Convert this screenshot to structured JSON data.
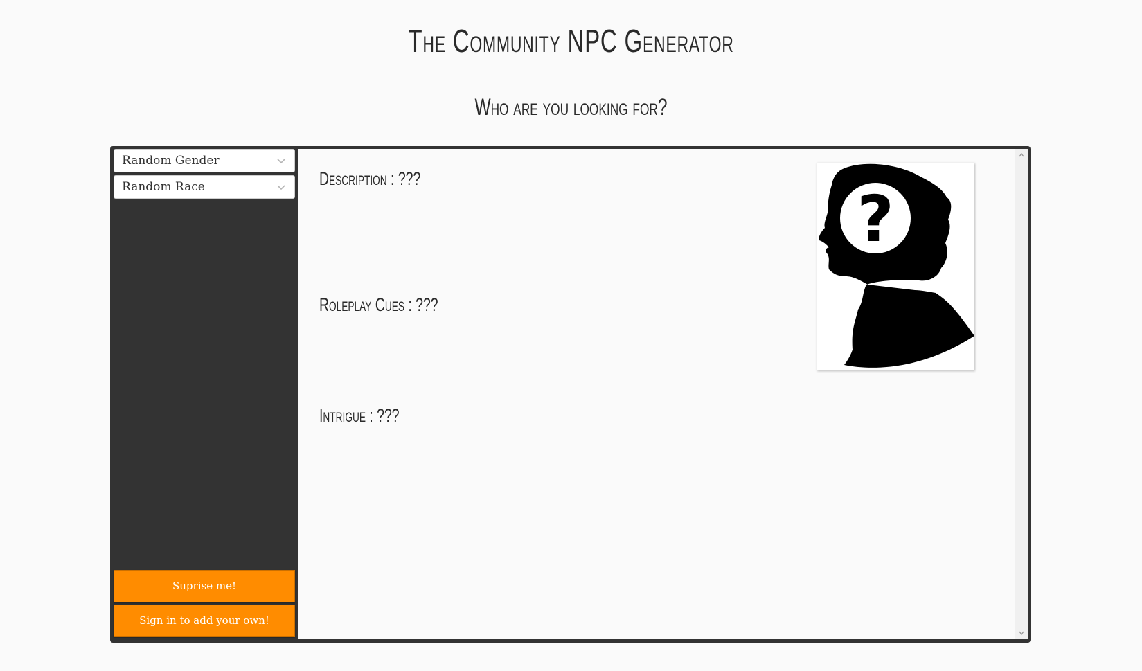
{
  "header": {
    "title_prefix": "T",
    "title_rest": "he Community NPC Generator",
    "subtitle": "Who are you looking for?"
  },
  "sidebar": {
    "gender_select": {
      "value": "Random Gender"
    },
    "race_select": {
      "value": "Random Race"
    },
    "surprise_button": "Suprise me!",
    "signin_button": "Sign in to add your own!"
  },
  "npc": {
    "description_label": "Description : ???",
    "roleplay_label": "Roleplay Cues : ???",
    "intrigue_label": "Intrigue : ???"
  },
  "colors": {
    "accent": "#ff8c00",
    "frame": "#333333",
    "background": "#fafafa"
  },
  "icons": {
    "select_arrow": "chevron-down-icon",
    "portrait": "silhouette-question-icon",
    "scroll_up": "scroll-up-arrow-icon",
    "scroll_down": "scroll-down-arrow-icon"
  }
}
